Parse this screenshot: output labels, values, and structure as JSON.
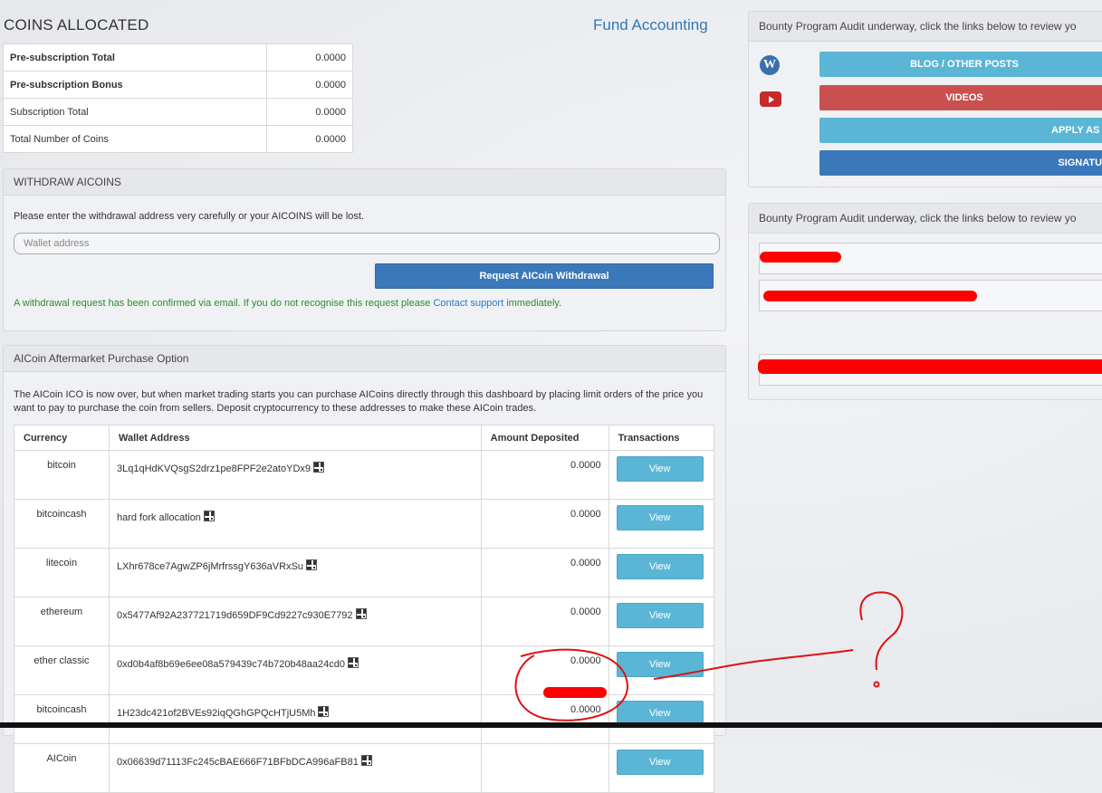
{
  "header": {
    "coins_title": "COINS ALLOCATED",
    "fund_link": "Fund Accounting"
  },
  "allocation": [
    {
      "label": "Pre-subscription Total",
      "value": "0.0000",
      "bold": true
    },
    {
      "label": "Pre-subscription Bonus",
      "value": "0.0000",
      "bold": true
    },
    {
      "label": "Subscription Total",
      "value": "0.0000",
      "bold": false
    },
    {
      "label": "Total Number of Coins",
      "value": "0.0000",
      "bold": false
    }
  ],
  "withdraw": {
    "title": "WITHDRAW AICOINS",
    "hint": "Please enter the withdrawal address very carefully or your AICOINS will be lost.",
    "placeholder": "Wallet address",
    "button": "Request AICoin Withdrawal",
    "confirm_prefix": "A withdrawal request has been confirmed via email. If you do not recognise this request please ",
    "confirm_link": "Contact support",
    "confirm_suffix": " immediately."
  },
  "aftermarket": {
    "title": "AICoin Aftermarket Purchase Option",
    "description": "The AICoin ICO is now over, but when market trading starts you can purchase AICoins directly through this dashboard by placing limit orders of the price you want to pay to purchase the coin from sellers. Deposit cryptocurrency to these addresses to make these AICoin trades.",
    "columns": [
      "Currency",
      "Wallet Address",
      "Amount Deposited",
      "Transactions"
    ],
    "view_label": "View",
    "rows": [
      {
        "currency": "bitcoin",
        "address": "3Lq1qHdKVQsgS2drz1pe8FPF2e2atoYDx9",
        "amount": "0.0000"
      },
      {
        "currency": "bitcoincash",
        "address": "hard fork allocation",
        "amount": "0.0000"
      },
      {
        "currency": "litecoin",
        "address": "LXhr678ce7AgwZP6jMrfrssgY636aVRxSu",
        "amount": "0.0000"
      },
      {
        "currency": "ethereum",
        "address": "0x5477Af92A237721719d659DF9Cd9227c930E7792",
        "amount": "0.0000"
      },
      {
        "currency": "ether classic",
        "address": "0xd0b4af8b69e6ee08a579439c74b720b48aa24cd0",
        "amount": "0.0000"
      },
      {
        "currency": "bitcoincash",
        "address": "1H23dc421of2BVEs92iqQGhGPQcHTjU5Mh",
        "amount": "0.0000"
      },
      {
        "currency": "AICoin",
        "address": "0x06639d71113Fc245cBAE666F71BFbDCA996aFB81",
        "amount": ""
      }
    ]
  },
  "bounty": {
    "header1": "Bounty Program Audit underway, click the links below to review yo",
    "header2": "Bounty Program Audit underway, click the links below to review yo",
    "buttons": [
      {
        "label": "BLOG / OTHER POSTS",
        "color": "#5bb6d6"
      },
      {
        "label": "VIDEOS",
        "color": "#c9504f"
      },
      {
        "label": "APPLY AS A",
        "color": "#5bb6d6"
      },
      {
        "label": "SIGNATUR",
        "color": "#3a78b9"
      }
    ],
    "icons": [
      "wordpress-icon",
      "youtube-icon"
    ]
  },
  "annotation": {
    "question_mark": "?"
  }
}
